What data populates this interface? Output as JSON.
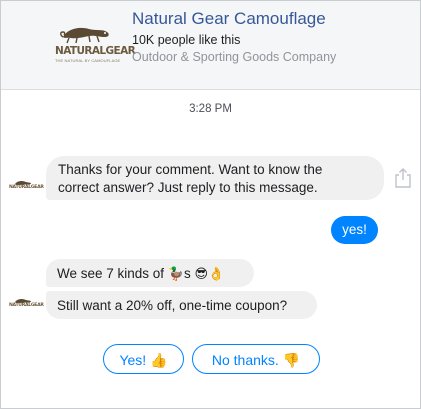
{
  "header": {
    "logo_text": "NATURALGEAR",
    "logo_tagline": "THE NATURAL BY CAMOUFLAGE",
    "page_name": "Natural Gear Camouflage",
    "likes": "10K people like this",
    "category": "Outdoor & Sporting Goods Company"
  },
  "thread": {
    "timestamp": "3:28 PM",
    "avatar_text": "NATURALGEAR",
    "messages": [
      {
        "from": "page",
        "line1": "Thanks for your comment. Want to know the",
        "line2": "correct answer? Just reply to this message."
      },
      {
        "from": "user",
        "text": "yes!"
      },
      {
        "from": "page",
        "text_before": "We see 7 kinds of ",
        "emoji_duck": "🦆",
        "text_after": "s",
        "emoji_trailing": "😎👌"
      },
      {
        "from": "page",
        "text": "Still want a 20% off, one-time coupon?"
      }
    ]
  },
  "quick_replies": [
    {
      "label": "Yes!",
      "emoji": "👍"
    },
    {
      "label": "No thanks.",
      "emoji": "👎"
    }
  ],
  "icons": {
    "share": "share-icon"
  },
  "colors": {
    "accent": "#0084ff",
    "page_name": "#365899",
    "bubble_bg": "#f1f0f0",
    "header_bg": "#f5f6f7"
  }
}
